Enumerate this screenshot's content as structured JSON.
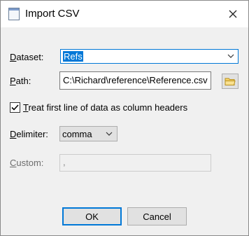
{
  "window": {
    "title": "Import CSV"
  },
  "fields": {
    "dataset": {
      "label_key": "D",
      "label_rest": "ataset:",
      "value": "Refs"
    },
    "path": {
      "label_key": "P",
      "label_rest": "ath:",
      "value": "C:\\Richard\\reference\\Reference.csv"
    },
    "header_checkbox": {
      "label_key": "T",
      "label_rest": "reat first line of data as column headers",
      "checked": true
    },
    "delimiter": {
      "label_key": "D",
      "label_rest": "elimiter:",
      "value": "comma"
    },
    "custom": {
      "label_key": "C",
      "label_rest": "ustom:",
      "value": ","
    }
  },
  "buttons": {
    "ok": "OK",
    "cancel": "Cancel"
  },
  "icons": {
    "close": "close-icon",
    "folder": "folder-icon",
    "app": "app-icon",
    "chevron": "chevron-down-icon",
    "check": "check-icon"
  }
}
